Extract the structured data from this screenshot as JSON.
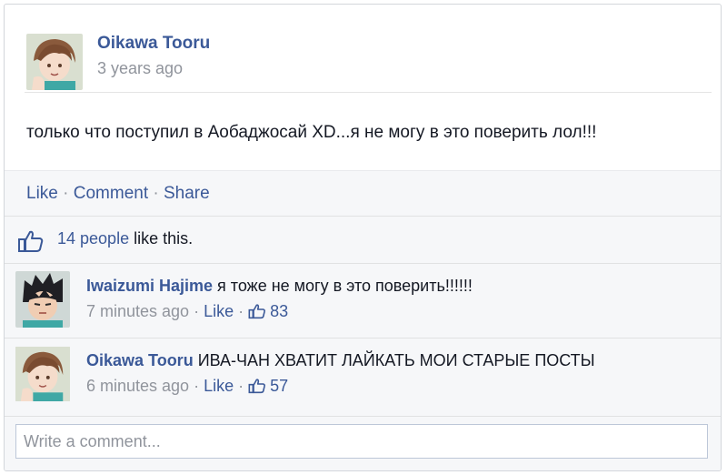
{
  "post": {
    "author": "Oikawa Tooru",
    "timestamp": "3 years ago",
    "text": "только что поступил в Аобаджосай XD...я не могу в это поверить лол!!!"
  },
  "actions": {
    "like": "Like",
    "sep1": " · ",
    "comment": "Comment",
    "sep2": " · ",
    "share": "Share"
  },
  "likes": {
    "count_text": "14 people",
    "suffix": " like this."
  },
  "comments": [
    {
      "author": "Iwaizumi Hajime",
      "text": " я тоже не могу в это поверить!!!!!!",
      "time": "7 minutes ago",
      "sep": " · ",
      "like": "Like",
      "sep2": " · ",
      "like_count": "83"
    },
    {
      "author": "Oikawa Tooru",
      "text": " ИВА-ЧАН ХВАТИТ ЛАЙКАТЬ МОИ СТАРЫЕ ПОСТЫ",
      "time": "6 minutes ago",
      "sep": " · ",
      "like": "Like",
      "sep2": " · ",
      "like_count": "57"
    }
  ],
  "composer": {
    "placeholder": "Write a comment..."
  },
  "colors": {
    "link": "#3b5998",
    "meta": "#90949c",
    "actions_bg": "#f6f7f9"
  },
  "icons": {
    "like": "thumbs-up-icon"
  }
}
